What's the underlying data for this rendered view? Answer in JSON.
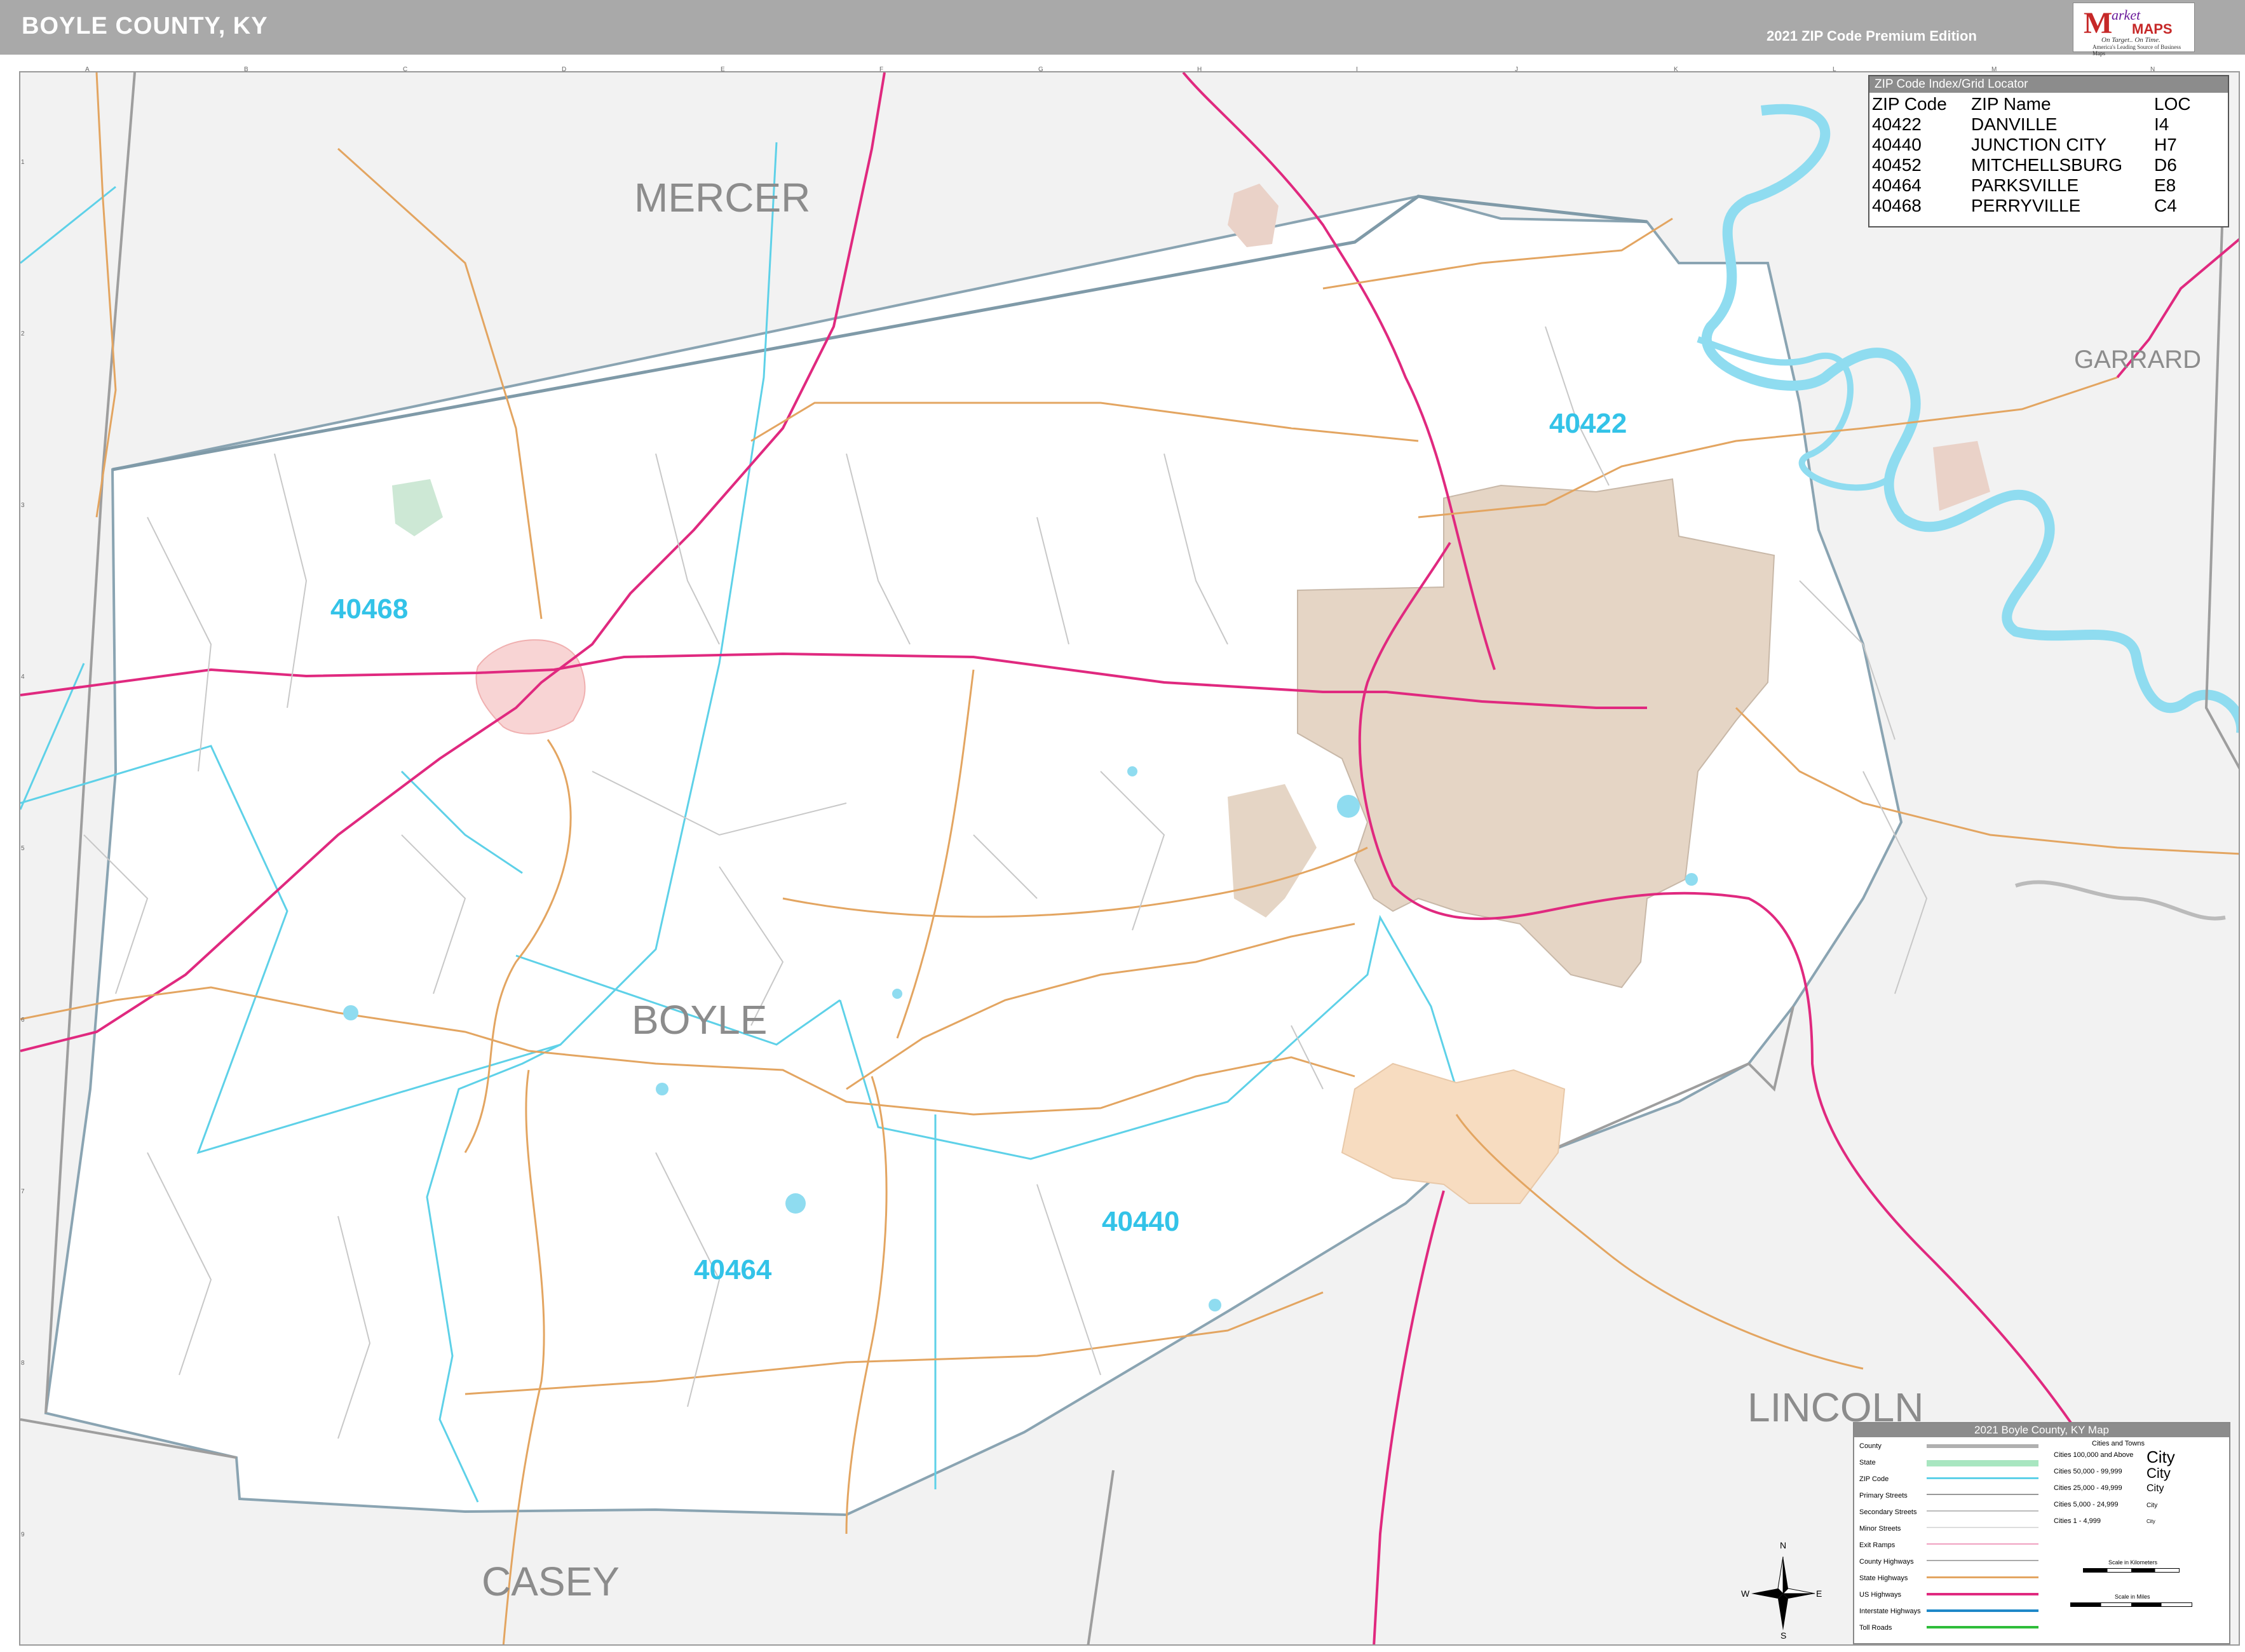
{
  "header": {
    "title": "BOYLE COUNTY, KY",
    "edition": "2021 ZIP Code Premium Edition"
  },
  "logo": {
    "m": "M",
    "arket": "arket",
    "maps": "MAPS",
    "tagline": "On Target.. On Time.",
    "subtagline": "America's Leading Source of Business Maps"
  },
  "map": {
    "counties": {
      "mercer": "MERCER",
      "garrard": "GARRARD",
      "boyle": "BOYLE",
      "lincoln": "LINCOLN",
      "casey": "CASEY"
    },
    "zip_labels": [
      "40422",
      "40468",
      "40464",
      "40440"
    ],
    "grid_letters": [
      "A",
      "B",
      "C",
      "D",
      "E",
      "F",
      "G",
      "H",
      "I",
      "J",
      "K",
      "L",
      "M",
      "N"
    ],
    "grid_numbers": [
      "1",
      "2",
      "3",
      "4",
      "5",
      "6",
      "7",
      "8",
      "9"
    ],
    "colors": {
      "outside_county": "#f2f2f2",
      "county_fill": "#ffffff",
      "zip_boundary": "#5ed1e8",
      "county_boundary": "#7f9aa8",
      "us_highway": "#e0297f",
      "state_highway": "#e3a561",
      "water": "#8fdcf0",
      "city_area": "#e5d5c5",
      "junction_city_area": "#f7dcc0",
      "perryville_area": "#f8d4d4"
    }
  },
  "index": {
    "title": "ZIP Code Index/Grid Locator",
    "headers": [
      "ZIP Code",
      "ZIP Name",
      "LOC"
    ],
    "rows": [
      [
        "40422",
        "DANVILLE",
        "I4"
      ],
      [
        "40440",
        "JUNCTION CITY",
        "H7"
      ],
      [
        "40452",
        "MITCHELLSBURG",
        "D6"
      ],
      [
        "40464",
        "PARKSVILLE",
        "E8"
      ],
      [
        "40468",
        "PERRYVILLE",
        "C4"
      ]
    ]
  },
  "legend": {
    "title": "2021 Boyle County, KY Map",
    "items": [
      "County",
      "State",
      "ZIP Code",
      "Primary Streets",
      "Secondary Streets",
      "Minor Streets",
      "Exit Ramps",
      "County Highways",
      "State Highways",
      "US Highways",
      "Interstate Highways",
      "Toll Roads"
    ],
    "cities_header": "Cities and Towns",
    "cities": [
      {
        "range": "Cities 100,000 and Above",
        "sample": "City"
      },
      {
        "range": "Cities 50,000 - 99,999",
        "sample": "City"
      },
      {
        "range": "Cities 25,000 - 49,999",
        "sample": "City"
      },
      {
        "range": "Cities 5,000 - 24,999",
        "sample": "City"
      },
      {
        "range": "Cities 1 - 4,999",
        "sample": "City"
      }
    ],
    "scale_km": "Scale in Kilometers",
    "scale_mi": "Scale in Miles"
  },
  "compass": {
    "n": "N",
    "s": "S",
    "e": "E",
    "w": "W"
  }
}
